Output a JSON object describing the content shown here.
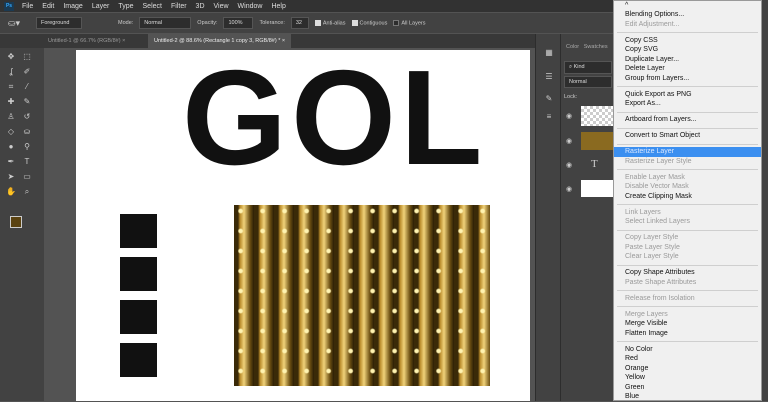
{
  "menubar": {
    "logo": "Ps",
    "items": [
      "File",
      "Edit",
      "Image",
      "Layer",
      "Type",
      "Select",
      "Filter",
      "3D",
      "View",
      "Window",
      "Help"
    ]
  },
  "options": {
    "fill_source": "Foreground",
    "mode_label": "Mode:",
    "mode": "Normal",
    "opacity_label": "Opacity:",
    "opacity": "100%",
    "tolerance_label": "Tolerance:",
    "tolerance": "32",
    "anti_alias": "Anti-alias",
    "contiguous": "Contiguous",
    "all_layers": "All Layers"
  },
  "tabs": [
    {
      "label": "Untitled-1 @ 66.7% (RGB/8#)",
      "close": "×"
    },
    {
      "label": "Untitled-2 @ 88.6% (Rectangle 1 copy 3, RGB/8#) *",
      "close": "×"
    }
  ],
  "canvas": {
    "headline": "GOL"
  },
  "panel": {
    "tabs": [
      "Color",
      "Swatches"
    ],
    "filter": "Kind",
    "blend": "Normal",
    "lock_label": "Lock:",
    "layer_type_glyph": "T"
  },
  "context_menu": {
    "scroll_up": "^",
    "groups": [
      [
        {
          "label": "Blending Options...",
          "enabled": true
        },
        {
          "label": "Edit Adjustment...",
          "enabled": false
        }
      ],
      [
        {
          "label": "Copy CSS",
          "enabled": true
        },
        {
          "label": "Copy SVG",
          "enabled": true
        },
        {
          "label": "Duplicate Layer...",
          "enabled": true
        },
        {
          "label": "Delete Layer",
          "enabled": true
        },
        {
          "label": "Group from Layers...",
          "enabled": true
        }
      ],
      [
        {
          "label": "Quick Export as PNG",
          "enabled": true
        },
        {
          "label": "Export As...",
          "enabled": true
        }
      ],
      [
        {
          "label": "Artboard from Layers...",
          "enabled": true
        }
      ],
      [
        {
          "label": "Convert to Smart Object",
          "enabled": true
        }
      ],
      [
        {
          "label": "Rasterize Layer",
          "enabled": true,
          "highlighted": true
        },
        {
          "label": "Rasterize Layer Style",
          "enabled": false
        }
      ],
      [
        {
          "label": "Enable Layer Mask",
          "enabled": false
        },
        {
          "label": "Disable Vector Mask",
          "enabled": false
        },
        {
          "label": "Create Clipping Mask",
          "enabled": true
        }
      ],
      [
        {
          "label": "Link Layers",
          "enabled": false
        },
        {
          "label": "Select Linked Layers",
          "enabled": false
        }
      ],
      [
        {
          "label": "Copy Layer Style",
          "enabled": false
        },
        {
          "label": "Paste Layer Style",
          "enabled": false
        },
        {
          "label": "Clear Layer Style",
          "enabled": false
        }
      ],
      [
        {
          "label": "Copy Shape Attributes",
          "enabled": true
        },
        {
          "label": "Paste Shape Attributes",
          "enabled": false
        }
      ],
      [
        {
          "label": "Release from Isolation",
          "enabled": false
        }
      ],
      [
        {
          "label": "Merge Layers",
          "enabled": false
        },
        {
          "label": "Merge Visible",
          "enabled": true
        },
        {
          "label": "Flatten Image",
          "enabled": true
        }
      ],
      [
        {
          "label": "No Color",
          "enabled": true
        },
        {
          "label": "Red",
          "enabled": true
        },
        {
          "label": "Orange",
          "enabled": true
        },
        {
          "label": "Yellow",
          "enabled": true
        },
        {
          "label": "Green",
          "enabled": true
        },
        {
          "label": "Blue",
          "enabled": true
        }
      ]
    ]
  },
  "colors": {
    "accent": "#3b8ff0",
    "foreground_swatch": "#5a4210"
  }
}
